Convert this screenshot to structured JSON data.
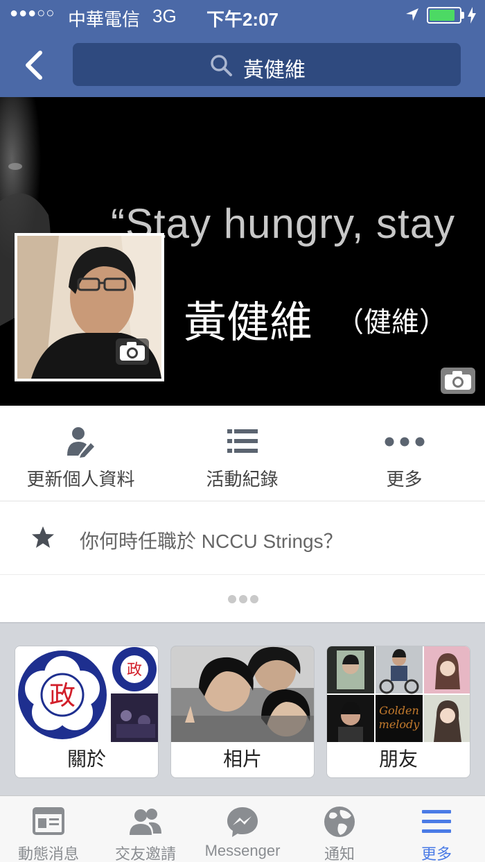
{
  "status_bar": {
    "signal": "●●●○○",
    "carrier": "中華電信",
    "network": "3G",
    "time": "下午2:07",
    "battery_level": 0.85
  },
  "search": {
    "query": "黃健維"
  },
  "cover": {
    "quote": "“Stay hungry, stay"
  },
  "profile": {
    "name": "黃健維",
    "nickname": "（健維）"
  },
  "actions": [
    {
      "label": "更新個人資料",
      "icon": "edit-profile-icon"
    },
    {
      "label": "活動紀錄",
      "icon": "list-icon"
    },
    {
      "label": "更多",
      "icon": "more-icon"
    }
  ],
  "prompt": {
    "text": "你何時任職於 NCCU Strings？",
    "icon": "star-icon"
  },
  "cards": [
    {
      "label": "關於",
      "seal_text": "政"
    },
    {
      "label": "相片"
    },
    {
      "label": "朋友"
    }
  ],
  "tabs": [
    {
      "label": "動態消息",
      "icon": "news-feed-icon"
    },
    {
      "label": "交友邀請",
      "icon": "friend-requests-icon"
    },
    {
      "label": "Messenger",
      "icon": "messenger-icon"
    },
    {
      "label": "通知",
      "icon": "globe-icon"
    },
    {
      "label": "更多",
      "icon": "menu-icon",
      "active": true
    }
  ],
  "colors": {
    "header": "#4b69a7",
    "search_field": "#2f4a7f",
    "battery": "#4cd964",
    "active_tab": "#4a7be6"
  }
}
